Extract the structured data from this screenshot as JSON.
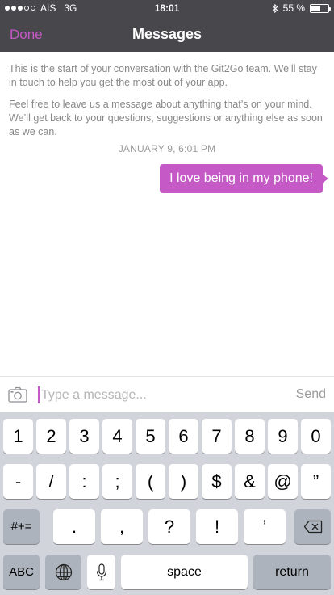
{
  "status_bar": {
    "carrier": "AIS",
    "network": "3G",
    "time": "18:01",
    "battery_text": "55 %",
    "battery_level": 0.55
  },
  "nav": {
    "done_label": "Done",
    "title": "Messages"
  },
  "conversation": {
    "intro_1": "This is the start of your conversation with the Git2Go team. We’ll stay in touch to help you get the most out of your app.",
    "intro_2": "Feel free to leave us a message about anything that’s on your mind. We’ll get back to your questions, suggestions or anything else as soon as we can.",
    "timestamp": "JANUARY 9, 6:01 PM",
    "messages": [
      {
        "text": "I love being in my phone!"
      }
    ]
  },
  "composer": {
    "placeholder": "Type a message...",
    "send_label": "Send"
  },
  "keyboard": {
    "row1": [
      "1",
      "2",
      "3",
      "4",
      "5",
      "6",
      "7",
      "8",
      "9",
      "0"
    ],
    "row2": [
      "-",
      "/",
      ":",
      ";",
      "(",
      ")",
      "$",
      "&",
      "@",
      "”"
    ],
    "row3": [
      ".",
      ",",
      "?",
      "!",
      "’"
    ],
    "symbols_label": "#+=",
    "abc_label": "ABC",
    "space_label": "space",
    "return_label": "return"
  },
  "colors": {
    "accent": "#c559c5",
    "header": "#48474c",
    "keyboard_bg": "#d1d5db"
  }
}
